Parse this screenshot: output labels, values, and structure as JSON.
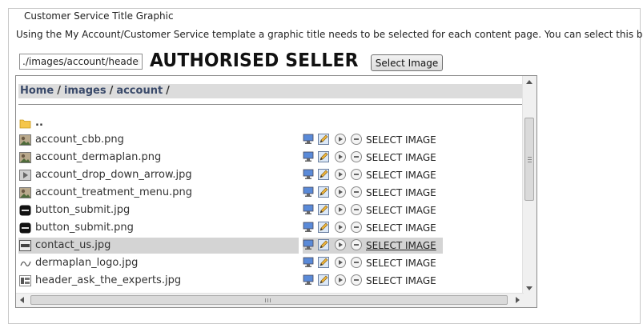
{
  "section": {
    "legend": "Customer Service Title Graphic",
    "description": "Using the My Account/Customer Service template a graphic title needs to be selected for each content page. You can select this below:"
  },
  "path_input": {
    "value": "./images/account/header_"
  },
  "title_graphic": {
    "text": "AUTHORISED SELLER"
  },
  "select_button": {
    "label": "Select Image"
  },
  "breadcrumb": {
    "home": "Home",
    "images": "images",
    "account": "account",
    "sep": "/"
  },
  "parent_dir": {
    "label": ".."
  },
  "action_label": "SELECT IMAGE",
  "files": [
    {
      "name": "account_cbb.png",
      "thumb": "photo-thumb-icon"
    },
    {
      "name": "account_dermaplan.png",
      "thumb": "photo-thumb-icon"
    },
    {
      "name": "account_drop_down_arrow.jpg",
      "thumb": "arrow-thumb-icon"
    },
    {
      "name": "account_treatment_menu.png",
      "thumb": "photo-thumb-icon"
    },
    {
      "name": "button_submit.jpg",
      "thumb": "submit-thumb-icon"
    },
    {
      "name": "button_submit.png",
      "thumb": "submit-thumb-icon"
    },
    {
      "name": "contact_us.jpg",
      "thumb": "text-thumb-icon",
      "selected": true
    },
    {
      "name": "dermaplan_logo.jpg",
      "thumb": "logo-thumb-icon"
    },
    {
      "name": "header_ask_the_experts.jpg",
      "thumb": "header-thumb-icon"
    }
  ],
  "colors": {
    "breadcrumb_bg": "#dcdcdc",
    "breadcrumb_text": "#3a4a6a",
    "selected_row": "#d4d4d4"
  },
  "scrollbar": {
    "h_grip": "III",
    "v_grip": "≡"
  }
}
